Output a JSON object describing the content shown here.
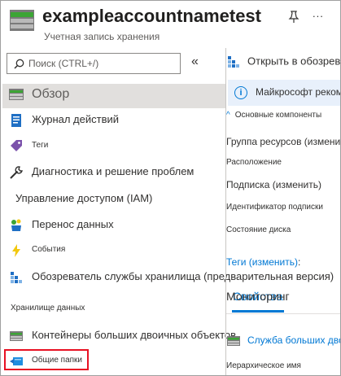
{
  "header": {
    "title": "exampleaccountnametest",
    "subtitle": "Учетная запись хранения",
    "more": "..."
  },
  "search": {
    "placeholder": "Поиск (CTRL+/)",
    "value": ""
  },
  "collapse_glyph": "«",
  "sidebar": {
    "items": [
      {
        "label": "Обзор",
        "icon": "storage-overview-icon"
      },
      {
        "label": "Журнал действий",
        "icon": "activity-log-icon"
      },
      {
        "label": "Теги",
        "icon": "tag-icon"
      },
      {
        "label": "Диагностика и решение проблем",
        "icon": "wrench-icon"
      },
      {
        "label": "Управление доступом (IAM)"
      },
      {
        "label": "Перенос данных",
        "icon": "data-transfer-icon"
      },
      {
        "label": "События",
        "icon": "lightning-icon"
      },
      {
        "label": "Обозреватель службы хранилища (предварительная версия)",
        "icon": "storage-explorer-icon"
      }
    ],
    "section_label": "Хранилище данных",
    "data_items": [
      {
        "label": "Контейнеры больших двоичных объектов",
        "icon": "blob-containers-icon"
      },
      {
        "label": "Общие папки",
        "icon": "file-shares-icon"
      }
    ]
  },
  "main": {
    "open_explorer": "Открыть в обозревателе",
    "info_text": "Майкрософт рекомендует",
    "essentials_label": "Основные компоненты",
    "essentials_chevron": "^",
    "properties": [
      {
        "label": "Группа ресурсов (изменить)"
      },
      {
        "label": "Расположение"
      },
      {
        "label": "Подписка (изменить)"
      },
      {
        "label": "Идентификатор подписки"
      },
      {
        "label": "Состояние диска"
      }
    ],
    "tags_link": "Теги (изменить)",
    "tags_colon": ":",
    "tabs": [
      {
        "label": "Свойства",
        "active": true
      },
      {
        "label": "Мониторинг",
        "active": false
      }
    ],
    "blob_service": "Служба больших двоичных объектов",
    "hierarchical_name": "Иерархическое имя"
  },
  "colors": {
    "accent": "#0078d4",
    "selection": "#e1dfdd",
    "highlight_border": "#e81123",
    "info_bg": "#e8f0fb"
  }
}
